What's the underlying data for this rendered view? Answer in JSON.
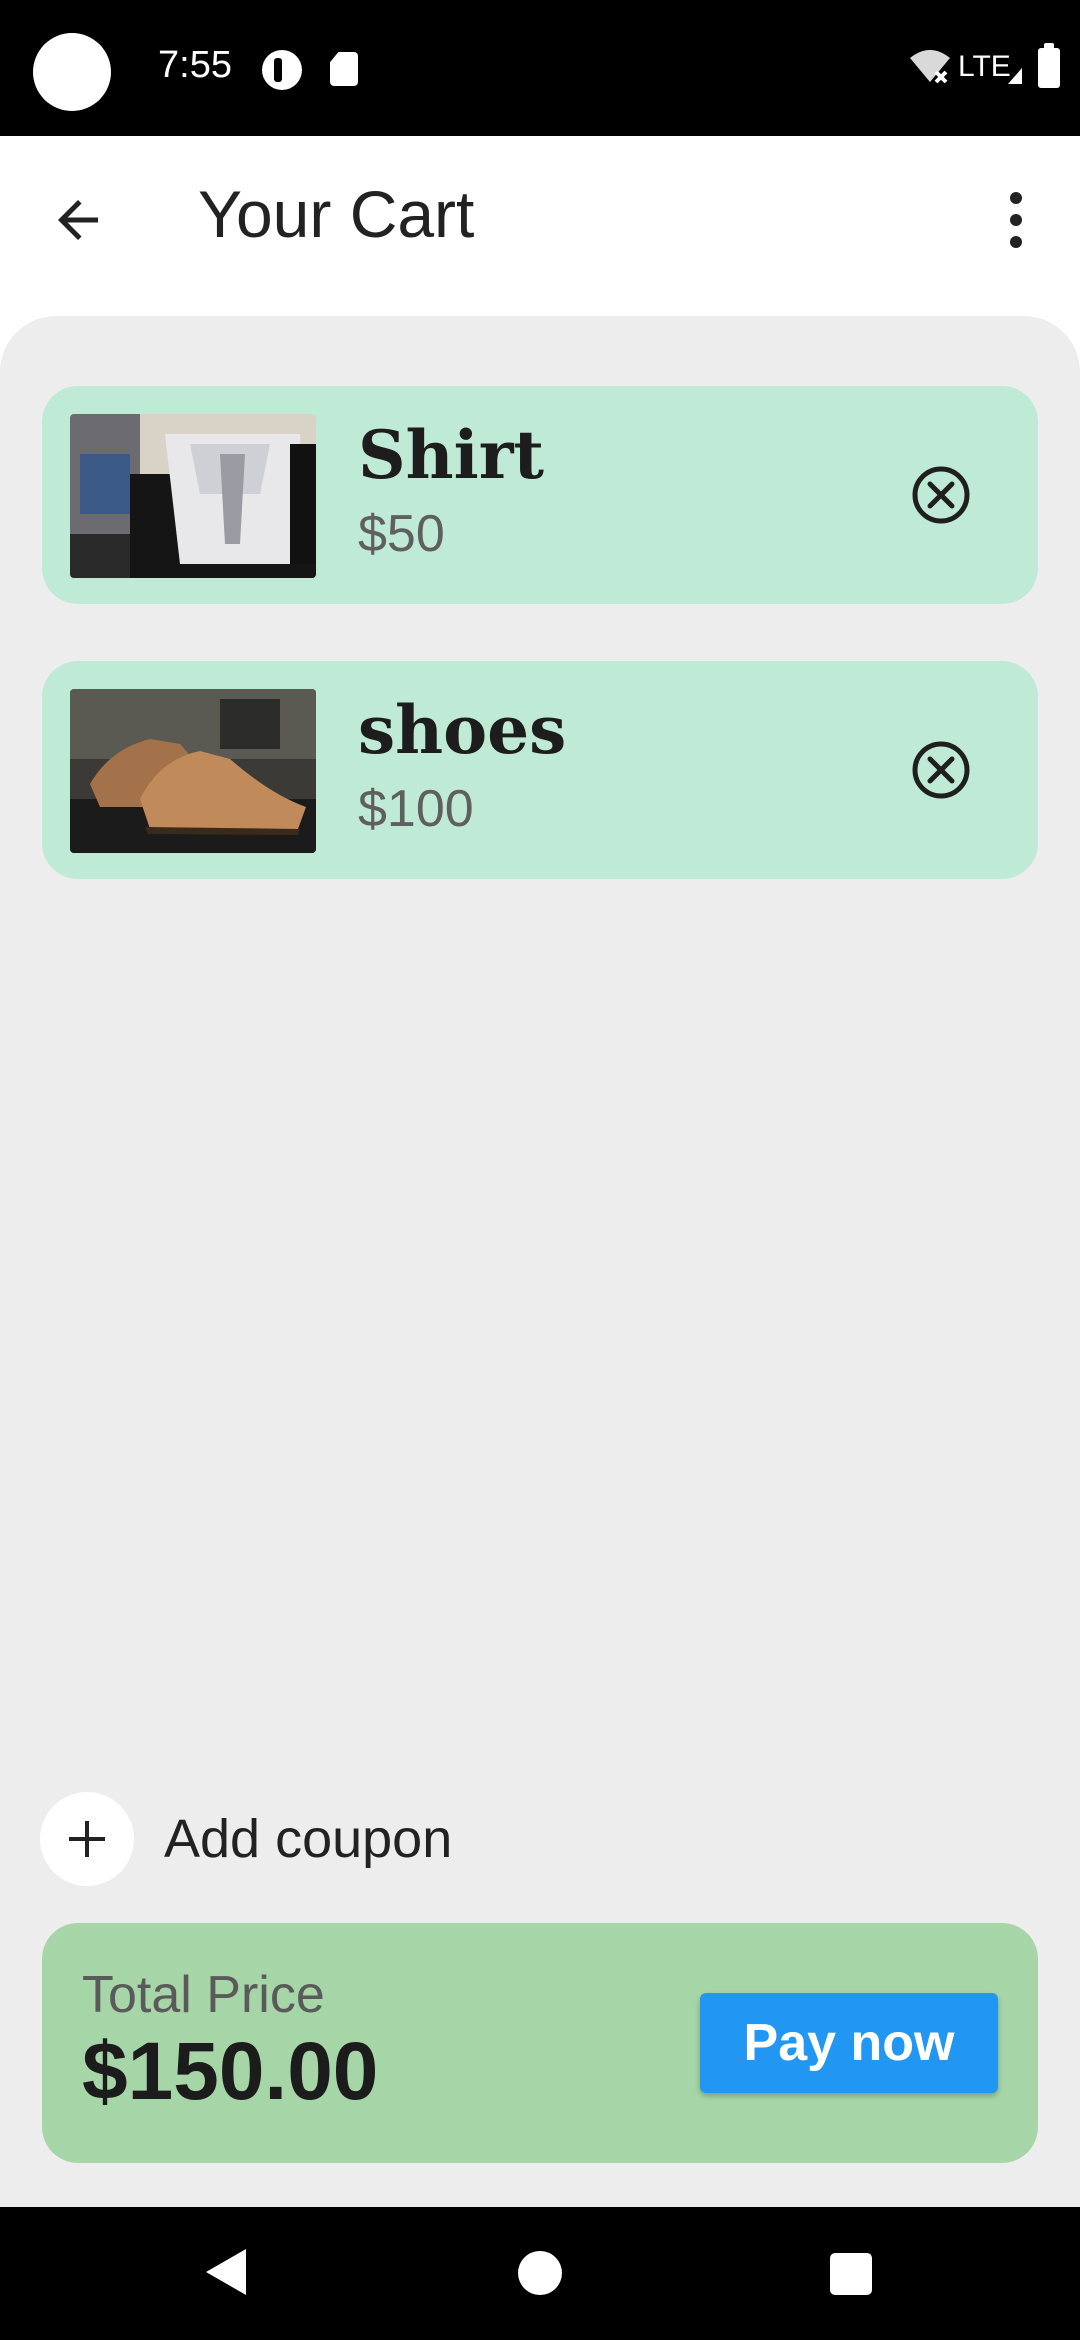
{
  "status_bar": {
    "time": "7:55",
    "network": "LTE",
    "icons": [
      "camera-cutout",
      "notification-app-icon",
      "sd-card-icon",
      "wifi-off-icon",
      "signal-icon",
      "battery-icon"
    ]
  },
  "app_bar": {
    "title": "Your Cart",
    "back_icon": "arrow-back-icon",
    "menu_icon": "more-vert-icon"
  },
  "cart": {
    "items": [
      {
        "name": "Shirt",
        "price": "$50",
        "image": "shirt-photo",
        "remove_icon": "remove-circle-icon"
      },
      {
        "name": "shoes",
        "price": "$100",
        "image": "shoes-photo",
        "remove_icon": "remove-circle-icon"
      }
    ]
  },
  "coupon": {
    "label": "Add coupon",
    "icon": "plus-icon"
  },
  "summary": {
    "total_label": "Total Price",
    "total_value": "$150.00",
    "pay_label": "Pay now"
  },
  "colors": {
    "item_bg": "#bfead6",
    "summary_bg": "#a6d6a7",
    "pay_button": "#2196f3",
    "content_bg": "#ededed"
  },
  "nav_bar": {
    "icons": [
      "nav-back-icon",
      "nav-home-icon",
      "nav-recents-icon"
    ]
  }
}
